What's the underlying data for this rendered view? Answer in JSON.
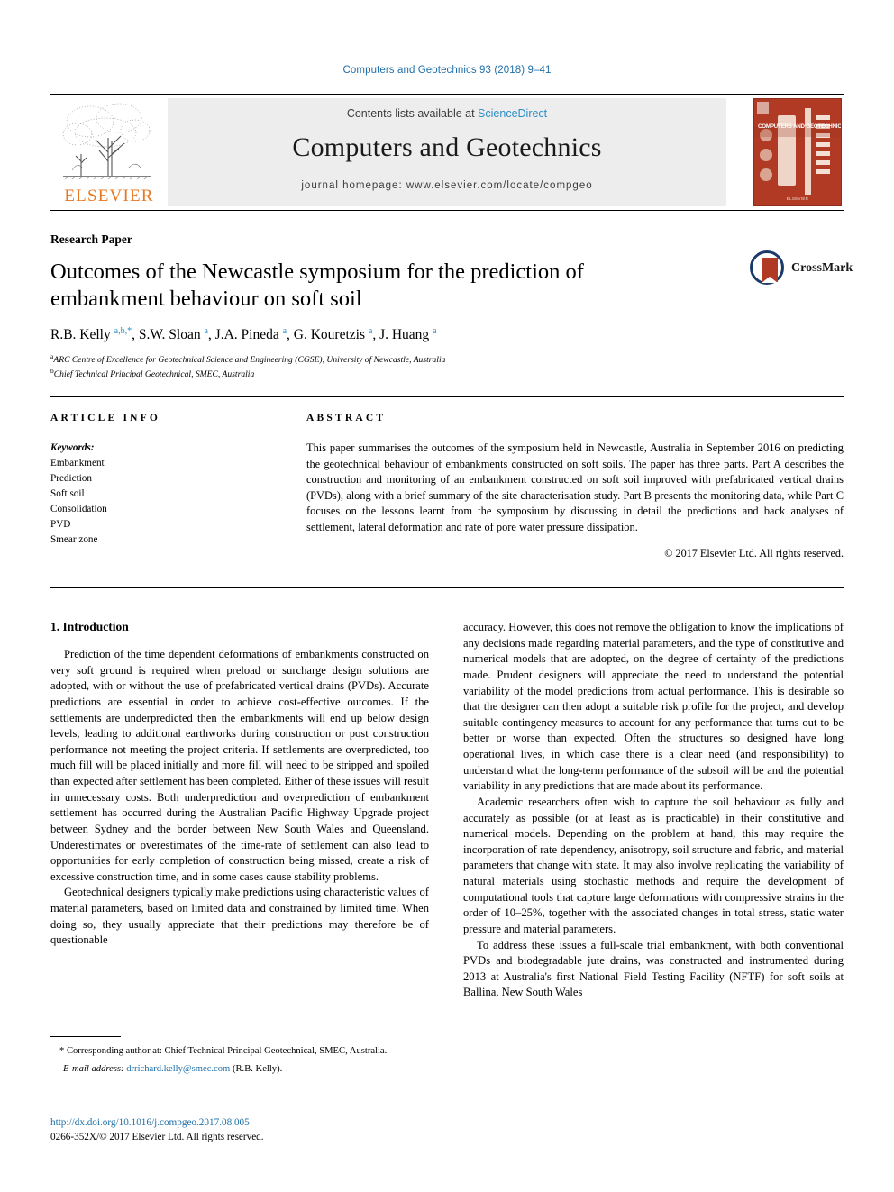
{
  "running_head": "Computers and Geotechnics 93 (2018) 9–41",
  "masthead": {
    "publisher_name": "ELSEVIER",
    "contents_prefix": "Contents lists available at ",
    "contents_link": "ScienceDirect",
    "journal_title": "Computers and Geotechnics",
    "homepage_line": "journal homepage: www.elsevier.com/locate/compgeo",
    "cover_title": "COMPUTERS AND GEOTECHNICS",
    "cover_footer": "ELSEVIER"
  },
  "article": {
    "type": "Research Paper",
    "title": "Outcomes of the Newcastle symposium for the prediction of embankment behaviour on soft soil",
    "authors_html": "R.B. Kelly <sup>a,b,*</sup>, S.W. Sloan <sup>a</sup>, J.A. Pineda <sup>a</sup>, G. Kouretzis <sup>a</sup>, J. Huang <sup>a</sup>",
    "affiliations": [
      {
        "marker": "a",
        "text": "ARC Centre of Excellence for Geotechnical Science and Engineering (CGSE), University of Newcastle, Australia"
      },
      {
        "marker": "b",
        "text": "Chief Technical Principal Geotechnical, SMEC, Australia"
      }
    ],
    "crossmark_label": "CrossMark"
  },
  "article_info": {
    "heading": "ARTICLE INFO",
    "keywords_label": "Keywords:",
    "keywords": [
      "Embankment",
      "Prediction",
      "Soft soil",
      "Consolidation",
      "PVD",
      "Smear zone"
    ]
  },
  "abstract": {
    "heading": "ABSTRACT",
    "text": "This paper summarises the outcomes of the symposium held in Newcastle, Australia in September 2016 on predicting the geotechnical behaviour of embankments constructed on soft soils. The paper has three parts. Part A describes the construction and monitoring of an embankment constructed on soft soil improved with prefabricated vertical drains (PVDs), along with a brief summary of the site characterisation study. Part B presents the monitoring data, while Part C focuses on the lessons learnt from the symposium by discussing in detail the predictions and back analyses of settlement, lateral deformation and rate of pore water pressure dissipation.",
    "copyright": "© 2017 Elsevier Ltd. All rights reserved."
  },
  "body": {
    "section_title": "1. Introduction",
    "left_paragraphs": [
      "Prediction of the time dependent deformations of embankments constructed on very soft ground is required when preload or surcharge design solutions are adopted, with or without the use of prefabricated vertical drains (PVDs). Accurate predictions are essential in order to achieve cost-effective outcomes. If the settlements are underpredicted then the embankments will end up below design levels, leading to additional earthworks during construction or post construction performance not meeting the project criteria. If settlements are overpredicted, too much fill will be placed initially and more fill will need to be stripped and spoiled than expected after settlement has been completed. Either of these issues will result in unnecessary costs. Both underprediction and overprediction of embankment settlement has occurred during the Australian Pacific Highway Upgrade project between Sydney and the border between New South Wales and Queensland. Underestimates or overestimates of the time-rate of settlement can also lead to opportunities for early completion of construction being missed, create a risk of excessive construction time, and in some cases cause stability problems.",
      "Geotechnical designers typically make predictions using characteristic values of material parameters, based on limited data and constrained by limited time. When doing so, they usually appreciate that their predictions may therefore be of questionable"
    ],
    "right_paragraphs": [
      "accuracy. However, this does not remove the obligation to know the implications of any decisions made regarding material parameters, and the type of constitutive and numerical models that are adopted, on the degree of certainty of the predictions made. Prudent designers will appreciate the need to understand the potential variability of the model predictions from actual performance. This is desirable so that the designer can then adopt a suitable risk profile for the project, and develop suitable contingency measures to account for any performance that turns out to be better or worse than expected. Often the structures so designed have long operational lives, in which case there is a clear need (and responsibility) to understand what the long-term performance of the subsoil will be and the potential variability in any predictions that are made about its performance.",
      "Academic researchers often wish to capture the soil behaviour as fully and accurately as possible (or at least as is practicable) in their constitutive and numerical models. Depending on the problem at hand, this may require the incorporation of rate dependency, anisotropy, soil structure and fabric, and material parameters that change with state. It may also involve replicating the variability of natural materials using stochastic methods and require the development of computational tools that capture large deformations with compressive strains in the order of 10–25%, together with the associated changes in total stress, static water pressure and material parameters.",
      "To address these issues a full-scale trial embankment, with both conventional PVDs and biodegradable jute drains, was constructed and instrumented during 2013 at Australia's first National Field Testing Facility (NFTF) for soft soils at Ballina, New South Wales"
    ]
  },
  "footnote": {
    "corresponding": "* Corresponding author at: Chief Technical Principal Geotechnical, SMEC, Australia.",
    "email_label": "E-mail address:",
    "email": "drrichard.kelly@smec.com",
    "email_suffix": "(R.B. Kelly)."
  },
  "footer": {
    "doi": "http://dx.doi.org/10.1016/j.compgeo.2017.08.005",
    "issn_line": "0266-352X/© 2017 Elsevier Ltd. All rights reserved."
  },
  "colors": {
    "link_blue": "#1f6fa8",
    "sciencedirect_blue": "#2b8fc5",
    "elsevier_orange": "#e87722",
    "cover_red": "#b03a24"
  }
}
